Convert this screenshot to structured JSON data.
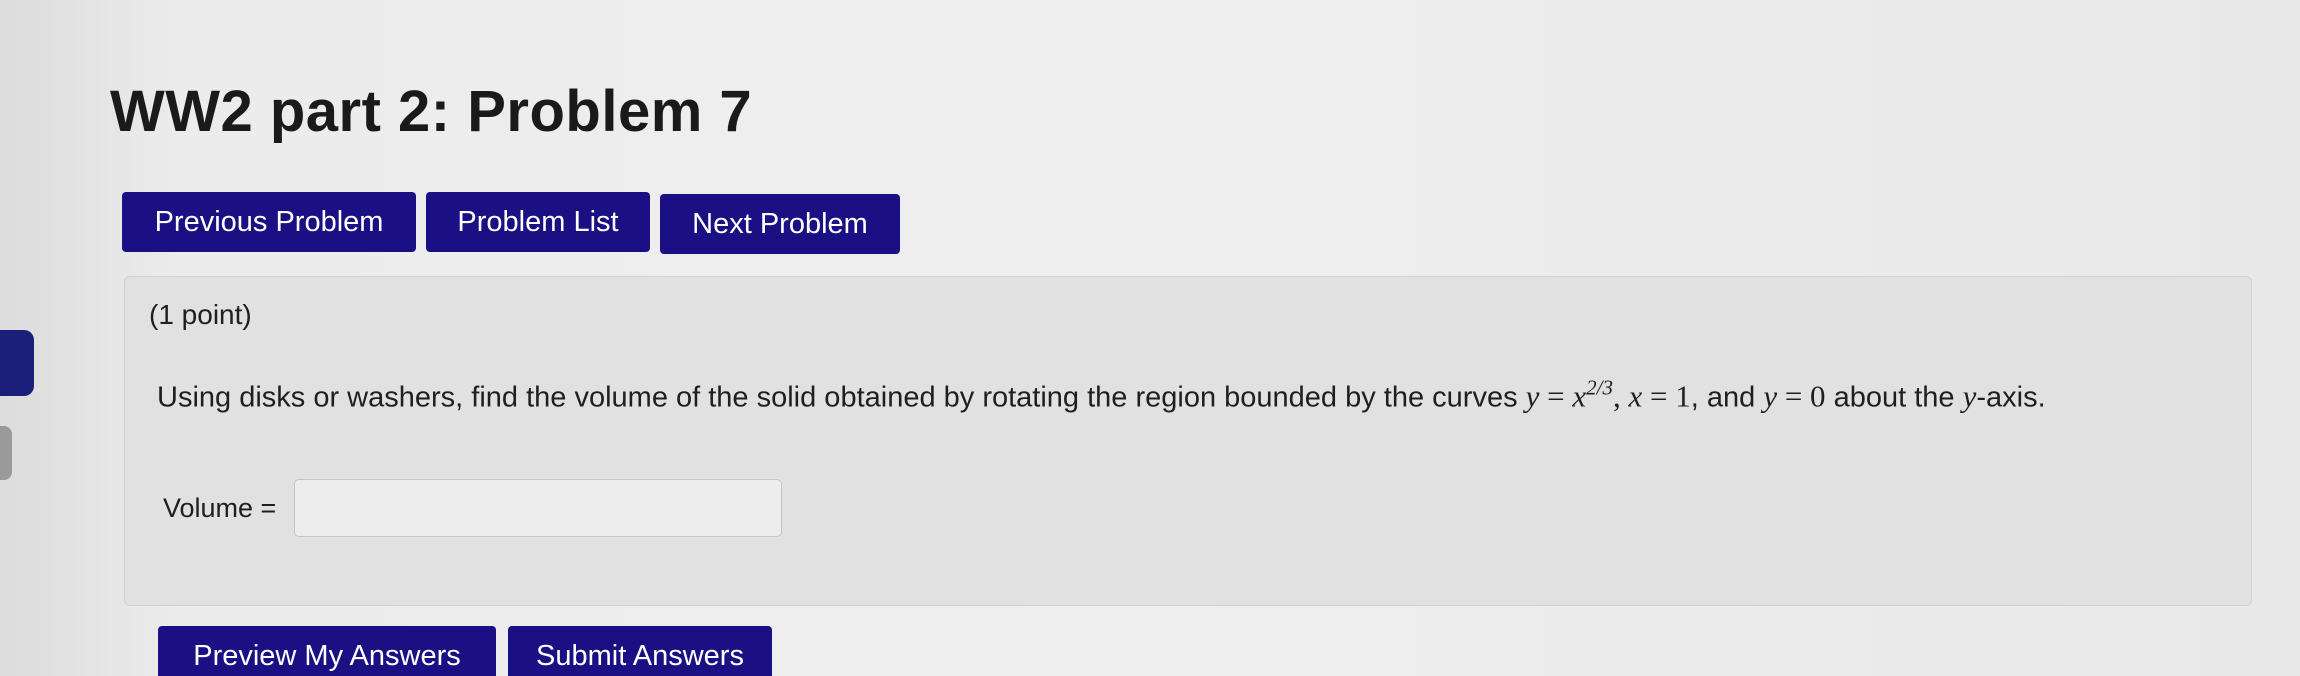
{
  "header": {
    "title": "WW2 part 2: Problem 7"
  },
  "nav": {
    "previous_label": "Previous Problem",
    "list_label": "Problem List",
    "next_label": "Next Problem"
  },
  "problem": {
    "points": "(1 point)",
    "text_before": "Using disks or washers, find the volume of the solid obtained by rotating the region bounded by the curves ",
    "math_y1": "y",
    "math_eq1": " = ",
    "math_x1": "x",
    "math_exp": "2/3",
    "sep1": ", ",
    "math_x2": "x",
    "math_eq2": " = 1",
    "sep2": ", and ",
    "math_y2": "y",
    "math_eq3": " = 0",
    "text_about": " about the ",
    "math_axis": "y",
    "text_after": "-axis."
  },
  "answer": {
    "label": "Volume =",
    "value": "",
    "placeholder": ""
  },
  "actions": {
    "preview_label": "Preview My Answers",
    "submit_label": "Submit Answers"
  },
  "colors": {
    "button_bg": "#1a0f83",
    "button_text": "#ffffff",
    "panel_bg": "#e1e1e1"
  }
}
